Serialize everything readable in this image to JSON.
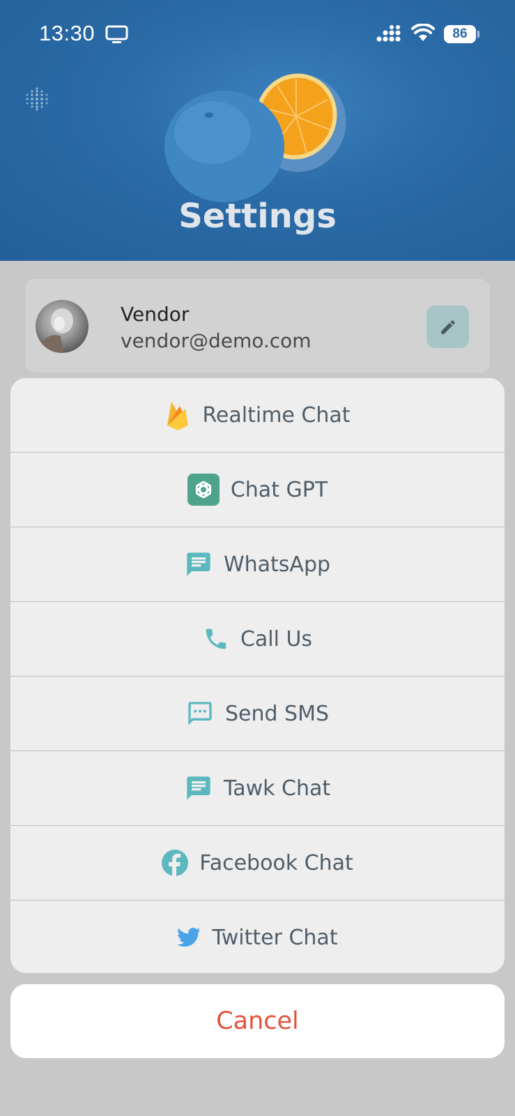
{
  "status_bar": {
    "time": "13:30",
    "battery": "86",
    "icons": [
      "monitor-icon",
      "signal-icon",
      "wifi-icon",
      "battery-icon"
    ]
  },
  "header": {
    "title": "Settings"
  },
  "profile": {
    "name": "Vendor",
    "email": "vendor@demo.com",
    "edit_icon": "pencil-icon"
  },
  "action_sheet": {
    "items": [
      {
        "label": "Realtime Chat",
        "icon": "firebase-icon"
      },
      {
        "label": "Chat GPT",
        "icon": "chatgpt-icon"
      },
      {
        "label": "WhatsApp",
        "icon": "message-icon"
      },
      {
        "label": "Call Us",
        "icon": "phone-icon"
      },
      {
        "label": "Send SMS",
        "icon": "sms-icon"
      },
      {
        "label": "Tawk Chat",
        "icon": "message-icon"
      },
      {
        "label": "Facebook Chat",
        "icon": "facebook-icon"
      },
      {
        "label": "Twitter Chat",
        "icon": "twitter-icon"
      }
    ],
    "cancel_label": "Cancel"
  },
  "colors": {
    "header_blue": "#2a6aa6",
    "accent_teal": "#5bb8bf",
    "cancel_red": "#e0533b",
    "label_gray": "#4f5d68"
  }
}
